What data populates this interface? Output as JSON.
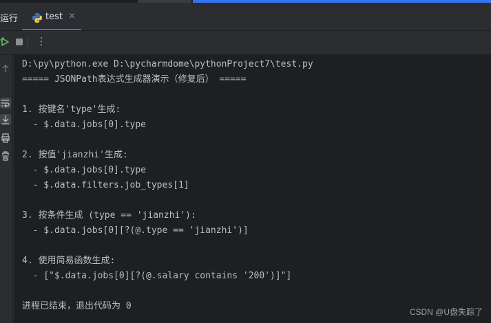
{
  "tabbar": {
    "run_label": "运行",
    "tab_name": "test",
    "tab_icon": "python-file-icon",
    "close_glyph": "×"
  },
  "toolbar": {
    "rerun_icon": "rerun-icon",
    "stop_icon": "stop-icon",
    "more_glyph": "⋮"
  },
  "sidebar": {
    "icons": [
      "scroll-up-icon",
      "soft-wrap-icon",
      "scroll-to-end-icon",
      "print-icon",
      "trash-icon"
    ]
  },
  "console": {
    "lines": [
      "D:\\py\\python.exe D:\\pycharmdome\\pythonProject7\\test.py",
      "===== JSONPath表达式生成器演示（修复后） =====",
      "",
      "1. 按键名'type'生成:",
      "  - $.data.jobs[0].type",
      "",
      "2. 按值'jianzhi'生成:",
      "  - $.data.jobs[0].type",
      "  - $.data.filters.job_types[1]",
      "",
      "3. 按条件生成 (type == 'jianzhi'):",
      "  - $.data.jobs[0][?(@.type == 'jianzhi')]",
      "",
      "4. 使用简易函数生成:",
      "  - [\"$.data.jobs[0][?(@.salary contains '200')]\"]",
      "",
      "进程已结束，退出代码为 0"
    ]
  },
  "watermark": "CSDN @U盘失踪了",
  "colors": {
    "console_bg": "#1e1f22",
    "panel_bg": "#2b2d30",
    "accent": "#3574f0",
    "text": "#bcbec4",
    "rerun_green": "#5fb865"
  }
}
